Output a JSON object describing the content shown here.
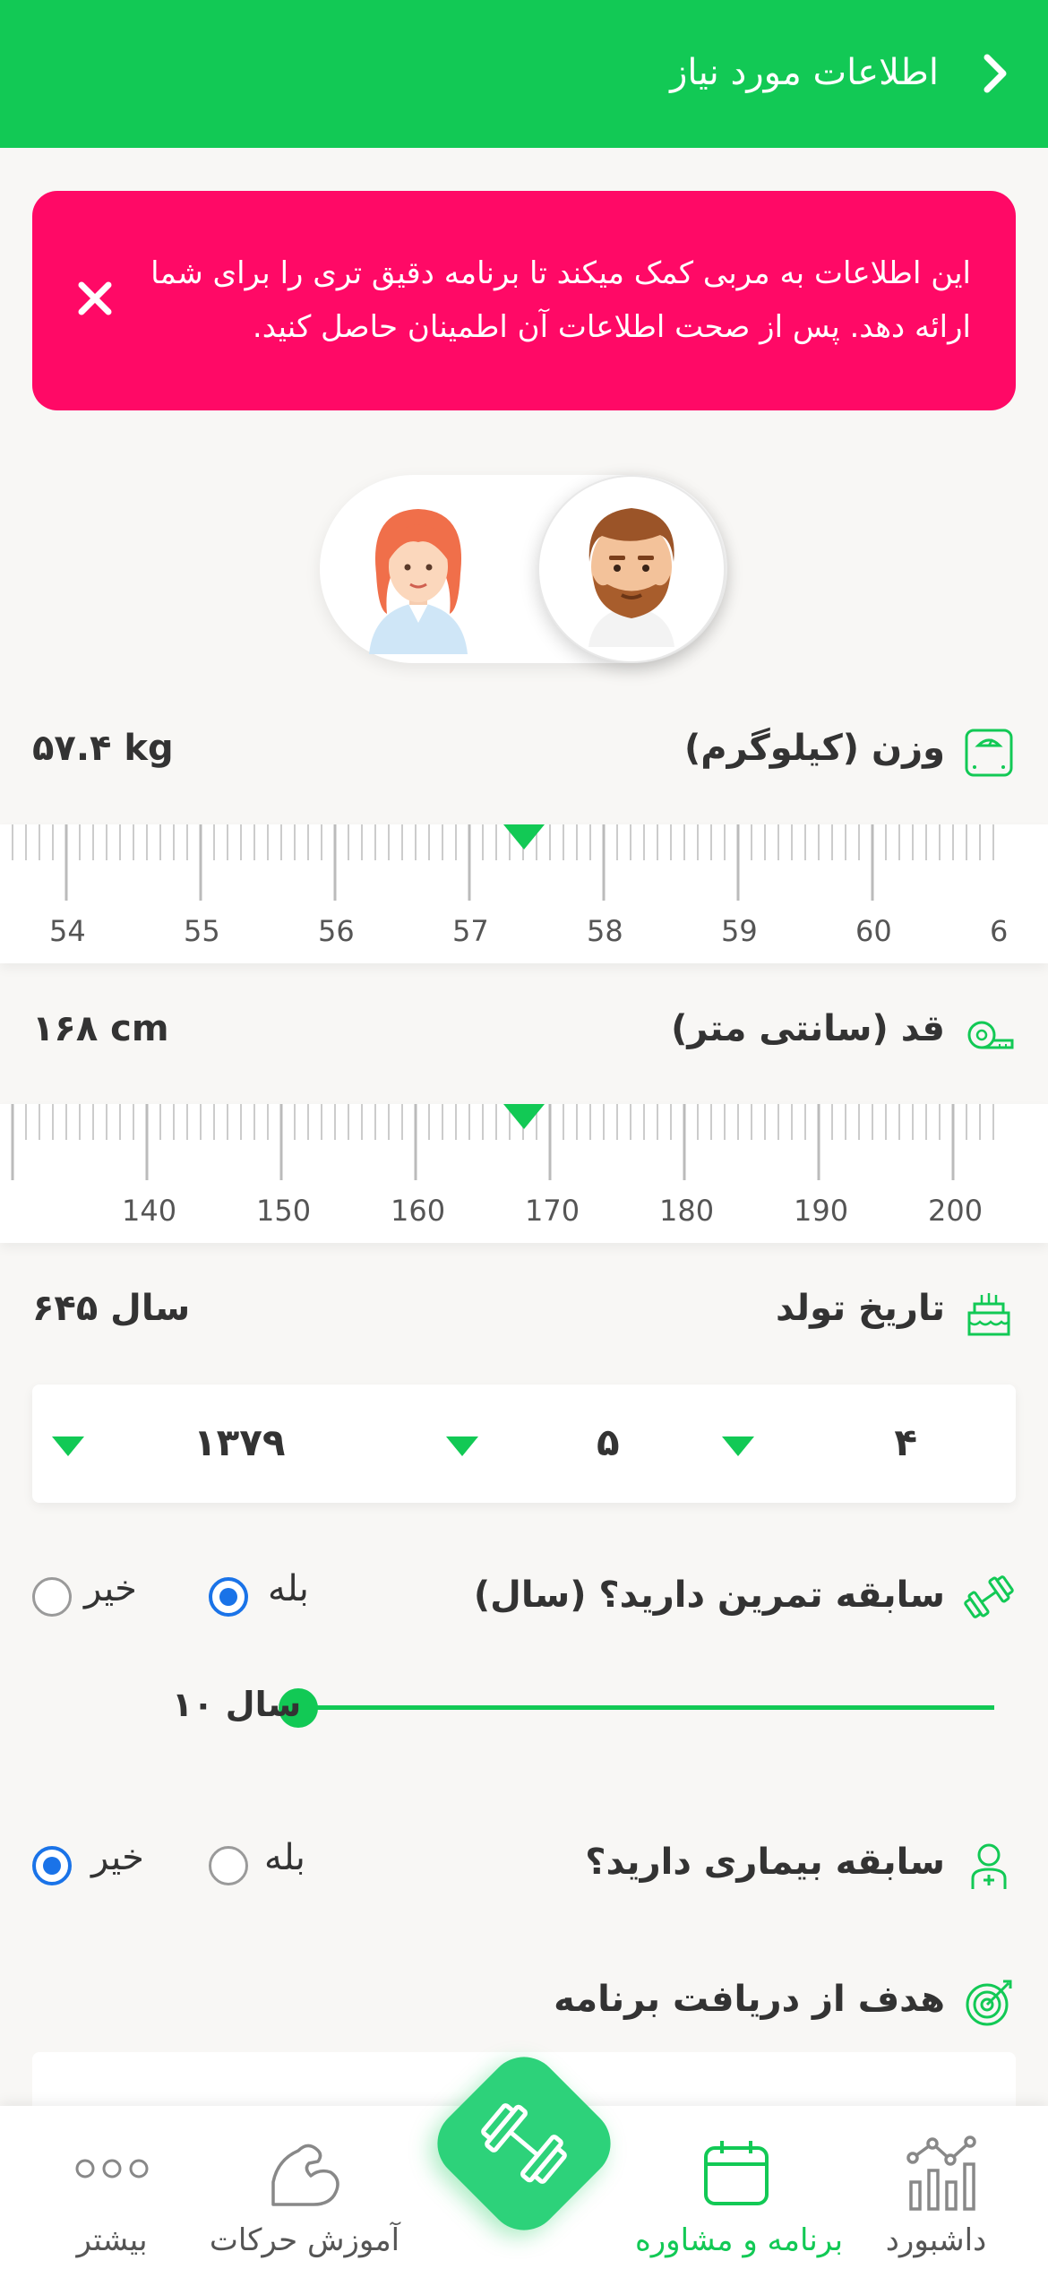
{
  "header": {
    "title": "اطلاعات مورد نیاز"
  },
  "alert": {
    "text": "این اطلاعات به مربی کمک میکند تا برنامه دقیق تری را برای شما ارائه دهد. پس از صحت اطلاعات آن اطمینان حاصل کنید."
  },
  "gender": {
    "selected": "male"
  },
  "weight": {
    "label": "وزن (کیلوگرم)",
    "value": "۵۷.۴ kg",
    "ticks": [
      "54",
      "55",
      "56",
      "57",
      "58",
      "59",
      "60",
      "6"
    ]
  },
  "height": {
    "label": "قد (سانتی متر)",
    "value": "۱۶۸ cm",
    "ticks": [
      "140",
      "150",
      "160",
      "170",
      "180",
      "190",
      "200"
    ]
  },
  "birth": {
    "label": "تاریخ تولد",
    "age": "۶۴۵ سال",
    "day": "۴",
    "month": "۵",
    "year": "۱۳۷۹"
  },
  "training": {
    "label": "سابقه تمرین دارید؟ (سال)",
    "yes": "بله",
    "no": "خیر",
    "selected": "yes",
    "years_label": "۱۰ سال"
  },
  "illness": {
    "label": "سابقه بیماری دارید؟",
    "yes": "بله",
    "no": "خیر",
    "selected": "no"
  },
  "goal": {
    "label": "هدف از دریافت برنامه"
  },
  "tabs": {
    "dashboard": "داشبورد",
    "program": "برنامه و مشاوره",
    "exercises": "آموزش حرکات",
    "more": "بیشتر"
  },
  "colors": {
    "accent": "#12c955",
    "alert": "#ff0966",
    "radio": "#1a73e8"
  }
}
